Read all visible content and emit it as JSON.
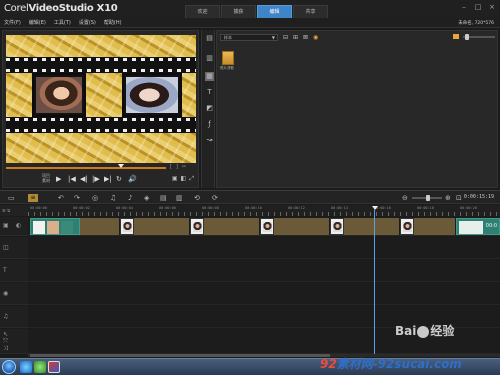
{
  "app": {
    "logo_brand": "Corel",
    "logo_product": "VideoStudio X10"
  },
  "tabs": [
    {
      "label": "欢迎",
      "active": false
    },
    {
      "label": "捕获",
      "active": false
    },
    {
      "label": "编辑",
      "active": true
    },
    {
      "label": "共享",
      "active": false
    }
  ],
  "window_buttons": [
    "–",
    "□",
    "×"
  ],
  "menu": [
    "文件(F)",
    "编辑(E)",
    "工具(T)",
    "设置(S)",
    "帮助(H)"
  ],
  "project_info": "未命名, 720*576",
  "player": {
    "mode_project": "项目",
    "mode_clip": "素材",
    "controls": [
      "▶",
      "|◀",
      "◀|",
      "|▶",
      "▶|",
      "↻",
      "🔊"
    ]
  },
  "library": {
    "folder_select": "样本",
    "item_label": "照片溃散"
  },
  "sidebar_icons": [
    "media-icon",
    "instant-project-icon",
    "transition-icon",
    "title-icon",
    "graphic-icon",
    "filter-icon",
    "motion-path-icon"
  ],
  "timeline": {
    "timecode": "0:00:15:19",
    "ruler_labels": [
      "00:00:00",
      "00:00:02",
      "00:00:04",
      "00:00:06",
      "00:00:08",
      "00:00:10",
      "00:00:12",
      "00:00:14",
      "00:00:16",
      "00:00:18",
      "00:00:20"
    ],
    "end_clip_label": "00:0"
  },
  "watermarks": {
    "baidu": "经验",
    "site_red": "92",
    "site_text": "素材网-92sucai.com"
  },
  "colors": {
    "accent_tab": "#3d85c6",
    "scrub_track": "#d07a1a",
    "playhead": "#5ba3e0",
    "clip_teal": "#2f7f72",
    "transition_brown": "#6b5a37"
  }
}
